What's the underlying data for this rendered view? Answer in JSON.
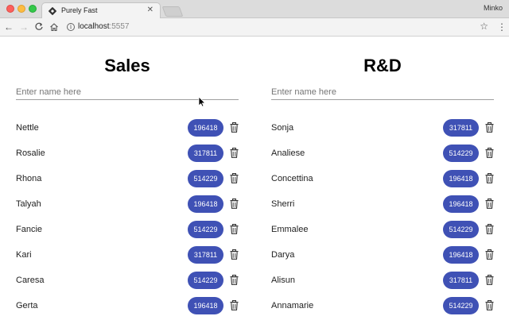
{
  "browser": {
    "tab_title": "Purely Fast",
    "tab_close": "✕",
    "profile_name": "Minko",
    "url_host": "localhost",
    "url_port": ":5557"
  },
  "icons": {
    "back": "←",
    "forward": "→",
    "reload": "C",
    "home": "⌂",
    "info": "i",
    "star": "☆",
    "menu": "⋮"
  },
  "colors": {
    "badge": "#3f51b5",
    "badge_text": "#ffffff"
  },
  "columns": [
    {
      "title": "Sales",
      "placeholder": "Enter name here",
      "employees": [
        {
          "name": "Nettle",
          "value": "196418"
        },
        {
          "name": "Rosalie",
          "value": "317811"
        },
        {
          "name": "Rhona",
          "value": "514229"
        },
        {
          "name": "Talyah",
          "value": "196418"
        },
        {
          "name": "Fancie",
          "value": "514229"
        },
        {
          "name": "Kari",
          "value": "317811"
        },
        {
          "name": "Caresa",
          "value": "514229"
        },
        {
          "name": "Gerta",
          "value": "196418"
        }
      ]
    },
    {
      "title": "R&D",
      "placeholder": "Enter name here",
      "employees": [
        {
          "name": "Sonja",
          "value": "317811"
        },
        {
          "name": "Analiese",
          "value": "514229"
        },
        {
          "name": "Concettina",
          "value": "196418"
        },
        {
          "name": "Sherri",
          "value": "196418"
        },
        {
          "name": "Emmalee",
          "value": "514229"
        },
        {
          "name": "Darya",
          "value": "196418"
        },
        {
          "name": "Alisun",
          "value": "317811"
        },
        {
          "name": "Annamarie",
          "value": "514229"
        }
      ]
    }
  ]
}
